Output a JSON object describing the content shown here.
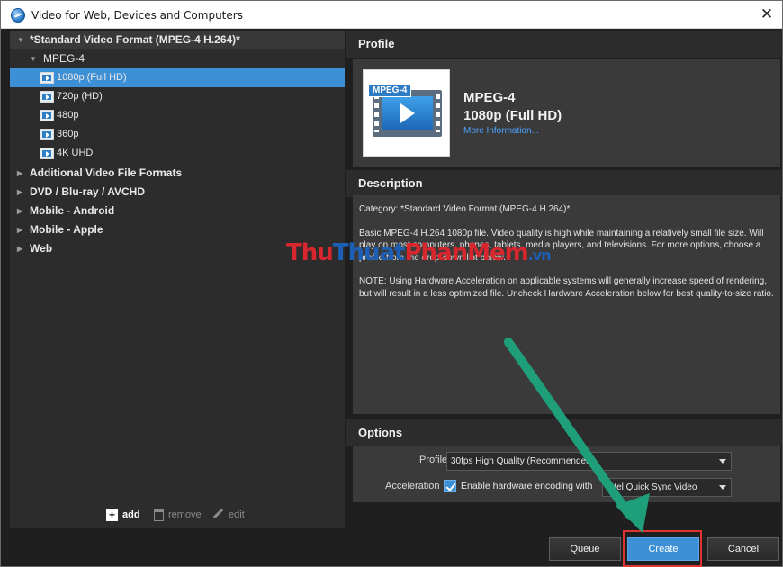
{
  "window": {
    "title": "Video for Web, Devices and Computers",
    "close_glyph": "✕"
  },
  "tree": {
    "top_category": "*Standard Video Format (MPEG-4 H.264)*",
    "subcategory": "MPEG-4",
    "items": [
      {
        "label": "1080p (Full HD)",
        "selected": true
      },
      {
        "label": "720p (HD)"
      },
      {
        "label": "480p"
      },
      {
        "label": "360p"
      },
      {
        "label": "4K UHD"
      }
    ],
    "categories": [
      "Additional Video File Formats",
      "DVD / Blu-ray / AVCHD",
      "Mobile - Android",
      "Mobile - Apple",
      "Web"
    ]
  },
  "toolbar": {
    "add_label": "add",
    "remove_label": "remove",
    "edit_label": "edit"
  },
  "profile": {
    "heading": "Profile",
    "thumb_tag": "MPEG-4",
    "title": "MPEG-4",
    "subtitle": "1080p (Full HD)",
    "more_info": "More Information..."
  },
  "description": {
    "heading": "Description",
    "category_line": "Category: *Standard Video Format (MPEG-4 H.264)*",
    "body": "Basic MPEG-4 H.264 1080p file. Video quality is high while maintaining a relatively small file size. Will play on most computers, phones, tablets, media players, and televisions. For more options, choose a profile from the drop-down list below.",
    "note": "NOTE: Using Hardware Acceleration on applicable systems will generally increase speed of rendering, but will result in a less optimized file. Uncheck Hardware Acceleration below for best quality-to-size ratio."
  },
  "options": {
    "heading": "Options",
    "profile_label": "Profile",
    "profile_value": "30fps High Quality (Recommended)",
    "acceleration_label": "Acceleration",
    "hw_checkbox_label": "Enable hardware encoding with",
    "hw_checked": true,
    "hw_value": "Intel Quick Sync Video"
  },
  "buttons": {
    "queue": "Queue",
    "create": "Create",
    "cancel": "Cancel"
  },
  "watermark": {
    "part1": "Thu",
    "part2": "Thuat",
    "part3": "PhanMem",
    "part4": ".vn"
  },
  "colors": {
    "accent": "#3d8fd6",
    "panel": "#3a3a3a",
    "annotation_arrow": "#1f9e7a",
    "highlight": "#e03434"
  }
}
